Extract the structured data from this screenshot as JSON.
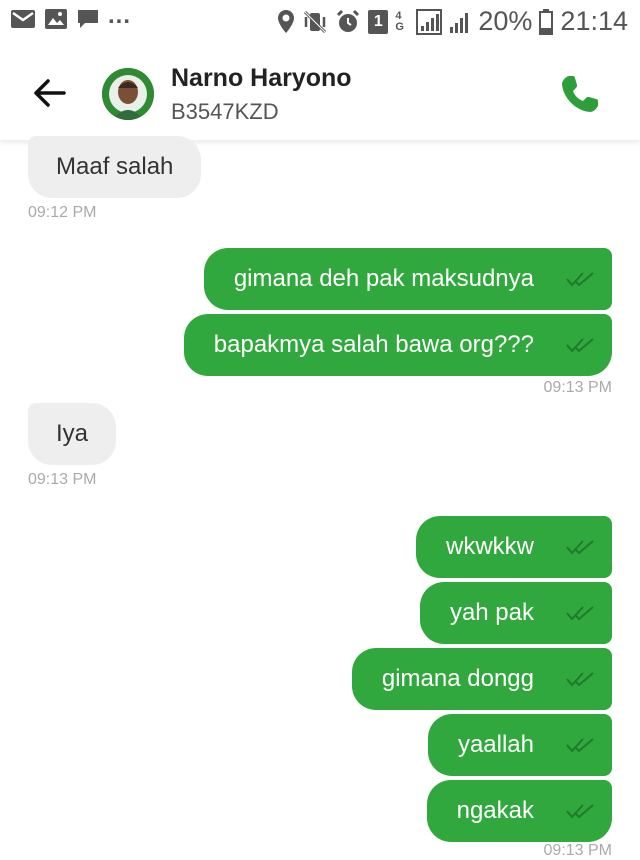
{
  "status_bar": {
    "ellipsis": "...",
    "sim_badge": "1",
    "network": "4G",
    "battery": "20%",
    "time": "21:14"
  },
  "contact": {
    "name": "Narno Haryono",
    "plate": "B3547KZD"
  },
  "colors": {
    "outgoing_bubble": "#30a83d",
    "incoming_bubble": "#eeeeee",
    "call_icon": "#2e9e3a"
  },
  "messages": [
    {
      "direction": "incoming",
      "text": "Maaf salah"
    },
    {
      "direction": "incoming_time",
      "text": "09:12 PM"
    },
    {
      "direction": "outgoing",
      "text": "gimana deh pak maksudnya"
    },
    {
      "direction": "outgoing",
      "text": "bapakmya salah bawa org???"
    },
    {
      "direction": "outgoing_time",
      "text": "09:13 PM"
    },
    {
      "direction": "incoming",
      "text": "Iya"
    },
    {
      "direction": "incoming_time",
      "text": "09:13 PM"
    },
    {
      "direction": "outgoing",
      "text": "wkwkkw"
    },
    {
      "direction": "outgoing",
      "text": "yah pak"
    },
    {
      "direction": "outgoing",
      "text": "gimana dongg"
    },
    {
      "direction": "outgoing",
      "text": "yaallah"
    },
    {
      "direction": "outgoing",
      "text": "ngakak"
    },
    {
      "direction": "outgoing_time",
      "text": "09:13 PM"
    }
  ]
}
